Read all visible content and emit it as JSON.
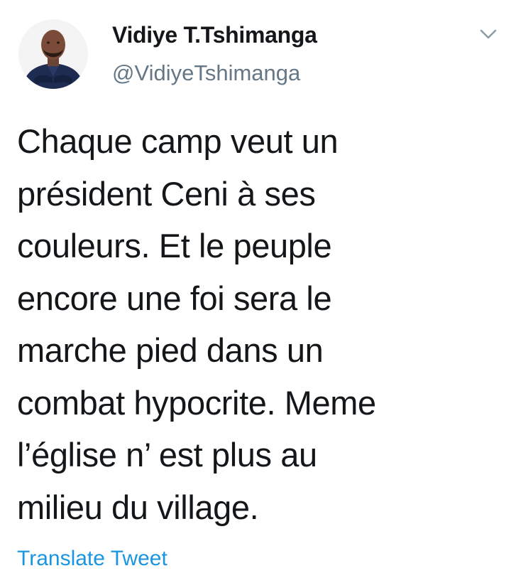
{
  "author": {
    "display_name": "Vidiye T.Tshimanga",
    "handle": "@VidiyeTshimanga"
  },
  "icons": {
    "menu": "chevron-down-icon",
    "avatar": "avatar-photo"
  },
  "tweet": {
    "lines": [
      "Chaque camp veut un",
      "président Ceni à ses",
      "couleurs. Et le peuple",
      "encore une foi sera le",
      "marche pied dans un",
      "combat hypocrite. Meme",
      "l’église n’ est plus au",
      "milieu du village."
    ],
    "translate_label": "Translate Tweet"
  },
  "colors": {
    "text": "#14171a",
    "secondary": "#657786",
    "link": "#1b95e0"
  }
}
